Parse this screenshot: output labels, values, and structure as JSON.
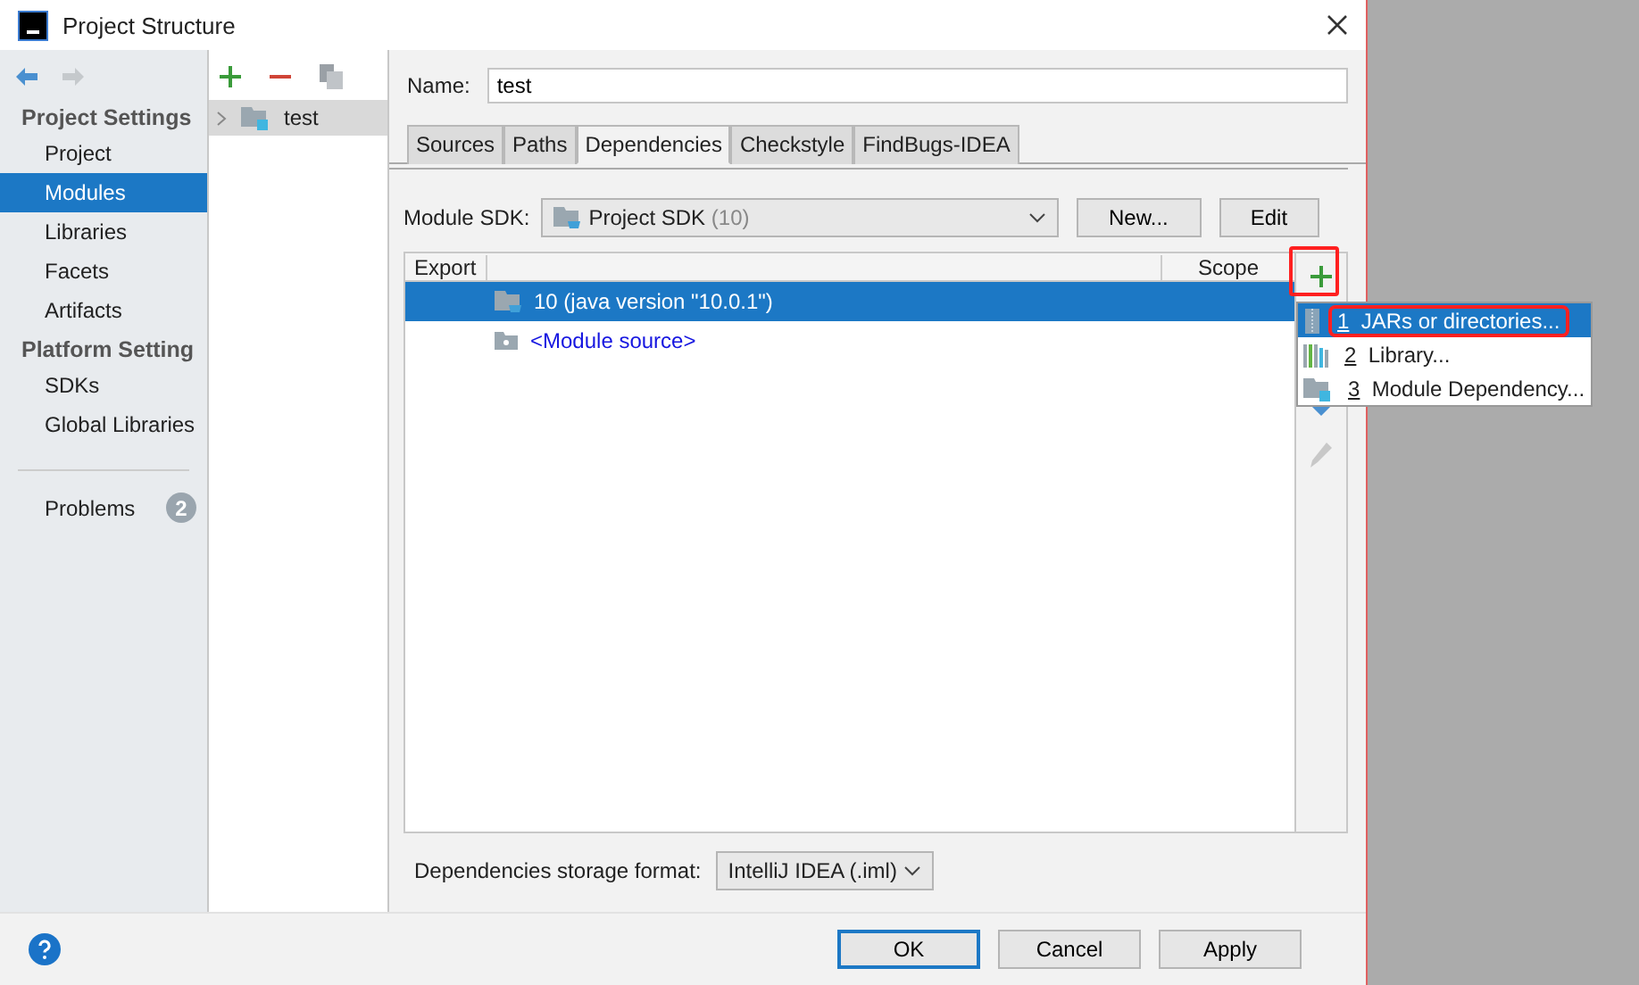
{
  "window": {
    "title": "Project Structure"
  },
  "nav": {
    "sections": [
      {
        "title": "Project Settings",
        "items": [
          {
            "label": "Project",
            "selected": false
          },
          {
            "label": "Modules",
            "selected": true
          },
          {
            "label": "Libraries",
            "selected": false
          },
          {
            "label": "Facets",
            "selected": false
          },
          {
            "label": "Artifacts",
            "selected": false
          }
        ]
      },
      {
        "title": "Platform Setting",
        "items": [
          {
            "label": "SDKs",
            "selected": false
          },
          {
            "label": "Global Libraries",
            "selected": false
          }
        ]
      }
    ],
    "problems": {
      "label": "Problems",
      "count": "2"
    }
  },
  "modules": [
    {
      "label": "test",
      "selected": true
    }
  ],
  "name_field": {
    "label": "Name:",
    "value": "test"
  },
  "tabs": [
    {
      "label": "Sources",
      "selected": false
    },
    {
      "label": "Paths",
      "selected": false
    },
    {
      "label": "Dependencies",
      "selected": true
    },
    {
      "label": "Checkstyle",
      "selected": false
    },
    {
      "label": "FindBugs-IDEA",
      "selected": false
    }
  ],
  "module_sdk": {
    "label": "Module SDK:",
    "value": "Project SDK",
    "hint": "(10)",
    "buttons": [
      "New...",
      "Edit"
    ]
  },
  "table": {
    "columns": [
      "Export",
      "Scope"
    ],
    "rows": [
      {
        "kind": "sdk",
        "label": "10 (java version \"10.0.1\")",
        "selected": true
      },
      {
        "kind": "source",
        "label": "<Module source>",
        "selected": false
      }
    ]
  },
  "add_menu": [
    {
      "number": "1",
      "label": "JARs or directories...",
      "selected": true,
      "kind": "jar"
    },
    {
      "number": "2",
      "label": "Library...",
      "selected": false,
      "kind": "library"
    },
    {
      "number": "3",
      "label": "Module Dependency...",
      "selected": false,
      "kind": "module"
    }
  ],
  "storage_format": {
    "label": "Dependencies storage format:",
    "value": "IntelliJ IDEA (.iml)"
  },
  "footer": {
    "buttons": [
      {
        "label": "OK",
        "default": true
      },
      {
        "label": "Cancel",
        "default": false
      },
      {
        "label": "Apply",
        "default": false
      }
    ]
  }
}
